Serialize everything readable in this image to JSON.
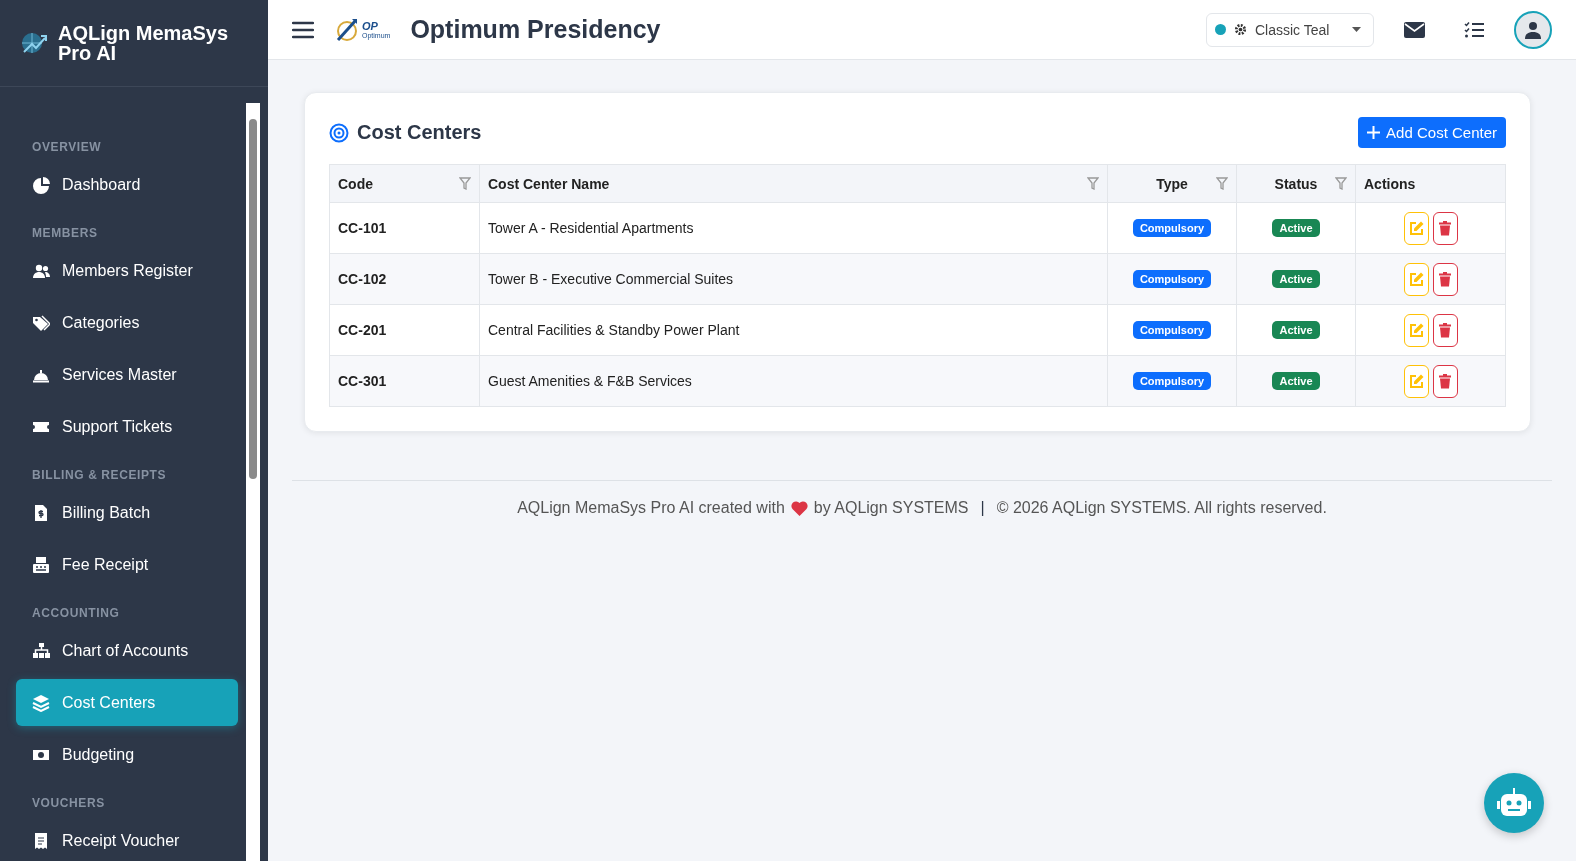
{
  "brand": {
    "name": "AQLign MemaSys Pro AI"
  },
  "sidebar": {
    "sections": [
      {
        "label": "OVERVIEW",
        "items": [
          {
            "label": "Dashboard",
            "selected": false
          }
        ]
      },
      {
        "label": "MEMBERS",
        "items": [
          {
            "label": "Members Register",
            "selected": false
          },
          {
            "label": "Categories",
            "selected": false
          },
          {
            "label": "Services Master",
            "selected": false
          },
          {
            "label": "Support Tickets",
            "selected": false
          }
        ]
      },
      {
        "label": "BILLING & RECEIPTS",
        "items": [
          {
            "label": "Billing Batch",
            "selected": false
          },
          {
            "label": "Fee Receipt",
            "selected": false
          }
        ]
      },
      {
        "label": "ACCOUNTING",
        "items": [
          {
            "label": "Chart of Accounts",
            "selected": false
          },
          {
            "label": "Cost Centers",
            "selected": true
          },
          {
            "label": "Budgeting",
            "selected": false
          }
        ]
      },
      {
        "label": "VOUCHERS",
        "items": [
          {
            "label": "Receipt Voucher",
            "selected": false
          }
        ]
      }
    ]
  },
  "header": {
    "logo_text": "OP",
    "logo_subtext": "Optimum",
    "title": "Optimum Presidency",
    "theme_select": {
      "value": "Classic Teal"
    }
  },
  "card": {
    "title": "Cost Centers",
    "add_button": "Add Cost Center",
    "table": {
      "columns": [
        {
          "label": "Code",
          "filter": true
        },
        {
          "label": "Cost Center Name",
          "filter": true
        },
        {
          "label": "Type",
          "filter": true
        },
        {
          "label": "Status",
          "filter": true
        },
        {
          "label": "Actions",
          "filter": false
        }
      ],
      "rows": [
        {
          "code": "CC-101",
          "name": "Tower A - Residential Apartments",
          "type": "Compulsory",
          "status": "Active"
        },
        {
          "code": "CC-102",
          "name": "Tower B - Executive Commercial Suites",
          "type": "Compulsory",
          "status": "Active"
        },
        {
          "code": "CC-201",
          "name": "Central Facilities & Standby Power Plant",
          "type": "Compulsory",
          "status": "Active"
        },
        {
          "code": "CC-301",
          "name": "Guest Amenities & F&B Services",
          "type": "Compulsory",
          "status": "Active"
        }
      ]
    }
  },
  "footer": {
    "credit_before": "AQLign MemaSys Pro AI created with",
    "credit_after": "by AQLign SYSTEMS",
    "separator": "|",
    "copyright": "© 2026 AQLign SYSTEMS. All rights reserved."
  }
}
